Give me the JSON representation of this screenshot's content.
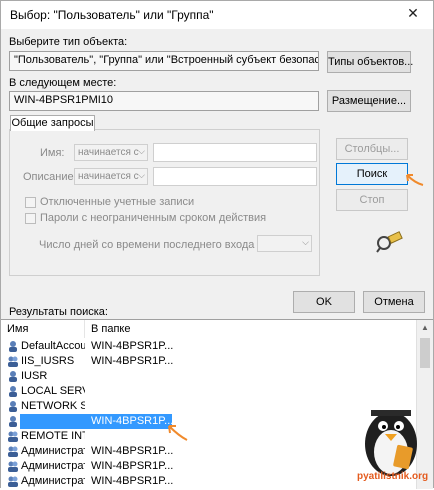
{
  "window": {
    "title": "Выбор: \"Пользователь\" или \"Группа\"",
    "close_glyph": "✕"
  },
  "object_type": {
    "label": "Выберите тип объекта:",
    "value": "\"Пользователь\", \"Группа\" или \"Встроенный субъект безопасности\"",
    "button": "Типы объектов..."
  },
  "location": {
    "label": "В следующем месте:",
    "value": "WIN-4BPSR1PMI10",
    "button": "Размещение..."
  },
  "common_queries": {
    "tab": "Общие запросы",
    "name_label": "Имя:",
    "name_combo": "начинается с",
    "desc_label": "Описание:",
    "desc_combo": "начинается с",
    "disabled_accounts": "Отключенные учетные записи",
    "no_expire_pwd": "Пароли с неограниченным сроком действия",
    "days_label": "Число дней со времени последнего входа в систему:"
  },
  "buttons": {
    "columns": "Столбцы...",
    "search": "Поиск",
    "stop": "Стоп",
    "ok": "OK",
    "cancel": "Отмена"
  },
  "results": {
    "label": "Результаты поиска:",
    "col_name": "Имя",
    "col_folder": "В папке",
    "rows": [
      {
        "name": "DefaultAccount",
        "folder": "WIN-4BPSR1P..."
      },
      {
        "name": "IIS_IUSRS",
        "folder": "WIN-4BPSR1P..."
      },
      {
        "name": "IUSR",
        "folder": ""
      },
      {
        "name": "LOCAL SERV...",
        "folder": ""
      },
      {
        "name": "NETWORK S...",
        "folder": ""
      },
      {
        "name": "",
        "folder": "WIN-4BPSR1P..."
      },
      {
        "name": "REMOTE INT...",
        "folder": ""
      },
      {
        "name": "Администрат...",
        "folder": "WIN-4BPSR1P..."
      },
      {
        "name": "Администрат...",
        "folder": "WIN-4BPSR1P..."
      },
      {
        "name": "Администрат...",
        "folder": "WIN-4BPSR1P..."
      }
    ]
  },
  "watermark": {
    "text": "pyatilistnik.org"
  },
  "colors": {
    "accent": "#0078d7",
    "selection": "#3399ff",
    "annotation": "#f08a2c"
  }
}
